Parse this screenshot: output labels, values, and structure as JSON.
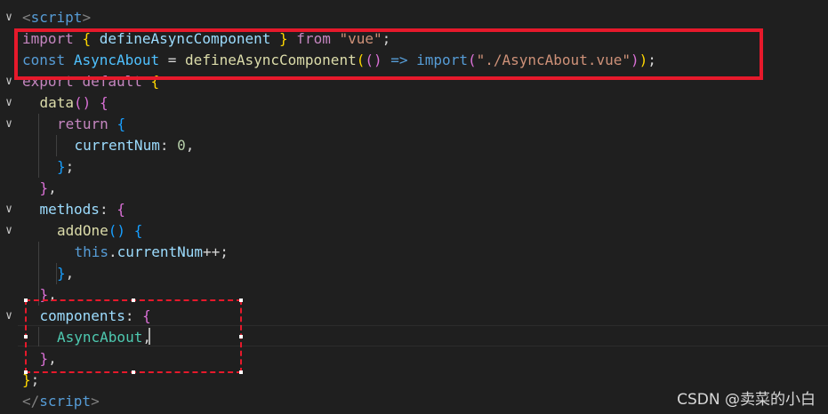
{
  "lines": [
    {
      "fold": true,
      "indent": 0,
      "tokens": [
        [
          "t-tag",
          "<"
        ],
        [
          "t-tagname",
          "script"
        ],
        [
          "t-tag",
          ">"
        ]
      ]
    },
    {
      "fold": false,
      "indent": 1,
      "tokens": [
        [
          "t-ctrl",
          "import"
        ],
        [
          "t-p",
          " "
        ],
        [
          "b1",
          "{"
        ],
        [
          "t-p",
          " "
        ],
        [
          "t-var",
          "defineAsyncComponent"
        ],
        [
          "t-p",
          " "
        ],
        [
          "b1",
          "}"
        ],
        [
          "t-p",
          " "
        ],
        [
          "t-ctrl",
          "from"
        ],
        [
          "t-p",
          " "
        ],
        [
          "t-str",
          "\"vue\""
        ],
        [
          "t-p",
          ";"
        ]
      ]
    },
    {
      "fold": false,
      "indent": 1,
      "tokens": [
        [
          "t-kw",
          "const"
        ],
        [
          "t-p",
          " "
        ],
        [
          "t-const",
          "AsyncAbout"
        ],
        [
          "t-p",
          " = "
        ],
        [
          "t-fn",
          "defineAsyncComponent"
        ],
        [
          "b1",
          "("
        ],
        [
          "b2",
          "()"
        ],
        [
          "t-p",
          " "
        ],
        [
          "t-kw",
          "=>"
        ],
        [
          "t-p",
          " "
        ],
        [
          "t-kw",
          "import"
        ],
        [
          "b2",
          "("
        ],
        [
          "t-str",
          "\"./AsyncAbout.vue\""
        ],
        [
          "b2",
          ")"
        ],
        [
          "b1",
          ")"
        ],
        [
          "t-p",
          ";"
        ]
      ]
    },
    {
      "fold": true,
      "indent": 1,
      "tokens": [
        [
          "t-ctrl",
          "export"
        ],
        [
          "t-p",
          " "
        ],
        [
          "t-ctrl",
          "default"
        ],
        [
          "t-p",
          " "
        ],
        [
          "b1",
          "{"
        ]
      ]
    },
    {
      "fold": true,
      "indent": 2,
      "tokens": [
        [
          "t-fn",
          "data"
        ],
        [
          "b2",
          "()"
        ],
        [
          "t-p",
          " "
        ],
        [
          "b2",
          "{"
        ]
      ]
    },
    {
      "fold": true,
      "indent": 3,
      "tokens": [
        [
          "t-ctrl",
          "return"
        ],
        [
          "t-p",
          " "
        ],
        [
          "b3",
          "{"
        ]
      ]
    },
    {
      "fold": false,
      "indent": 4,
      "tokens": [
        [
          "t-var",
          "currentNum"
        ],
        [
          "t-p",
          ": "
        ],
        [
          "t-num",
          "0"
        ],
        [
          "t-p",
          ","
        ]
      ]
    },
    {
      "fold": false,
      "indent": 3,
      "tokens": [
        [
          "b3",
          "}"
        ],
        [
          "t-p",
          ";"
        ]
      ]
    },
    {
      "fold": false,
      "indent": 2,
      "tokens": [
        [
          "b2",
          "}"
        ],
        [
          "t-p",
          ","
        ]
      ]
    },
    {
      "fold": true,
      "indent": 2,
      "tokens": [
        [
          "t-var",
          "methods"
        ],
        [
          "t-p",
          ": "
        ],
        [
          "b2",
          "{"
        ]
      ]
    },
    {
      "fold": true,
      "indent": 3,
      "tokens": [
        [
          "t-fn",
          "addOne"
        ],
        [
          "b3",
          "()"
        ],
        [
          "t-p",
          " "
        ],
        [
          "b3",
          "{"
        ]
      ]
    },
    {
      "fold": false,
      "indent": 4,
      "tokens": [
        [
          "t-kw",
          "this"
        ],
        [
          "t-p",
          "."
        ],
        [
          "t-var",
          "currentNum"
        ],
        [
          "t-p",
          "++;"
        ]
      ]
    },
    {
      "fold": false,
      "indent": 3,
      "tokens": [
        [
          "b3",
          "}"
        ],
        [
          "t-p",
          ","
        ]
      ]
    },
    {
      "fold": false,
      "indent": 2,
      "tokens": [
        [
          "b2",
          "}"
        ],
        [
          "t-p",
          ","
        ]
      ]
    },
    {
      "fold": true,
      "indent": 2,
      "tokens": [
        [
          "t-var",
          "components"
        ],
        [
          "t-p",
          ": "
        ],
        [
          "b2",
          "{"
        ]
      ]
    },
    {
      "fold": false,
      "indent": 3,
      "tokens": [
        [
          "t-comp",
          "AsyncAbout"
        ],
        [
          "t-p",
          ","
        ]
      ]
    },
    {
      "fold": false,
      "indent": 2,
      "tokens": [
        [
          "b2",
          "}"
        ],
        [
          "t-p",
          ","
        ]
      ]
    },
    {
      "fold": false,
      "indent": 1,
      "tokens": [
        [
          "b1",
          "}"
        ],
        [
          "t-p",
          ";"
        ]
      ]
    },
    {
      "fold": false,
      "indent": 0,
      "tokens": [
        [
          "t-tag",
          "</"
        ],
        [
          "t-tagname",
          "script"
        ],
        [
          "t-tag",
          ">"
        ]
      ]
    }
  ],
  "watermark": "CSDN @卖菜的小白"
}
